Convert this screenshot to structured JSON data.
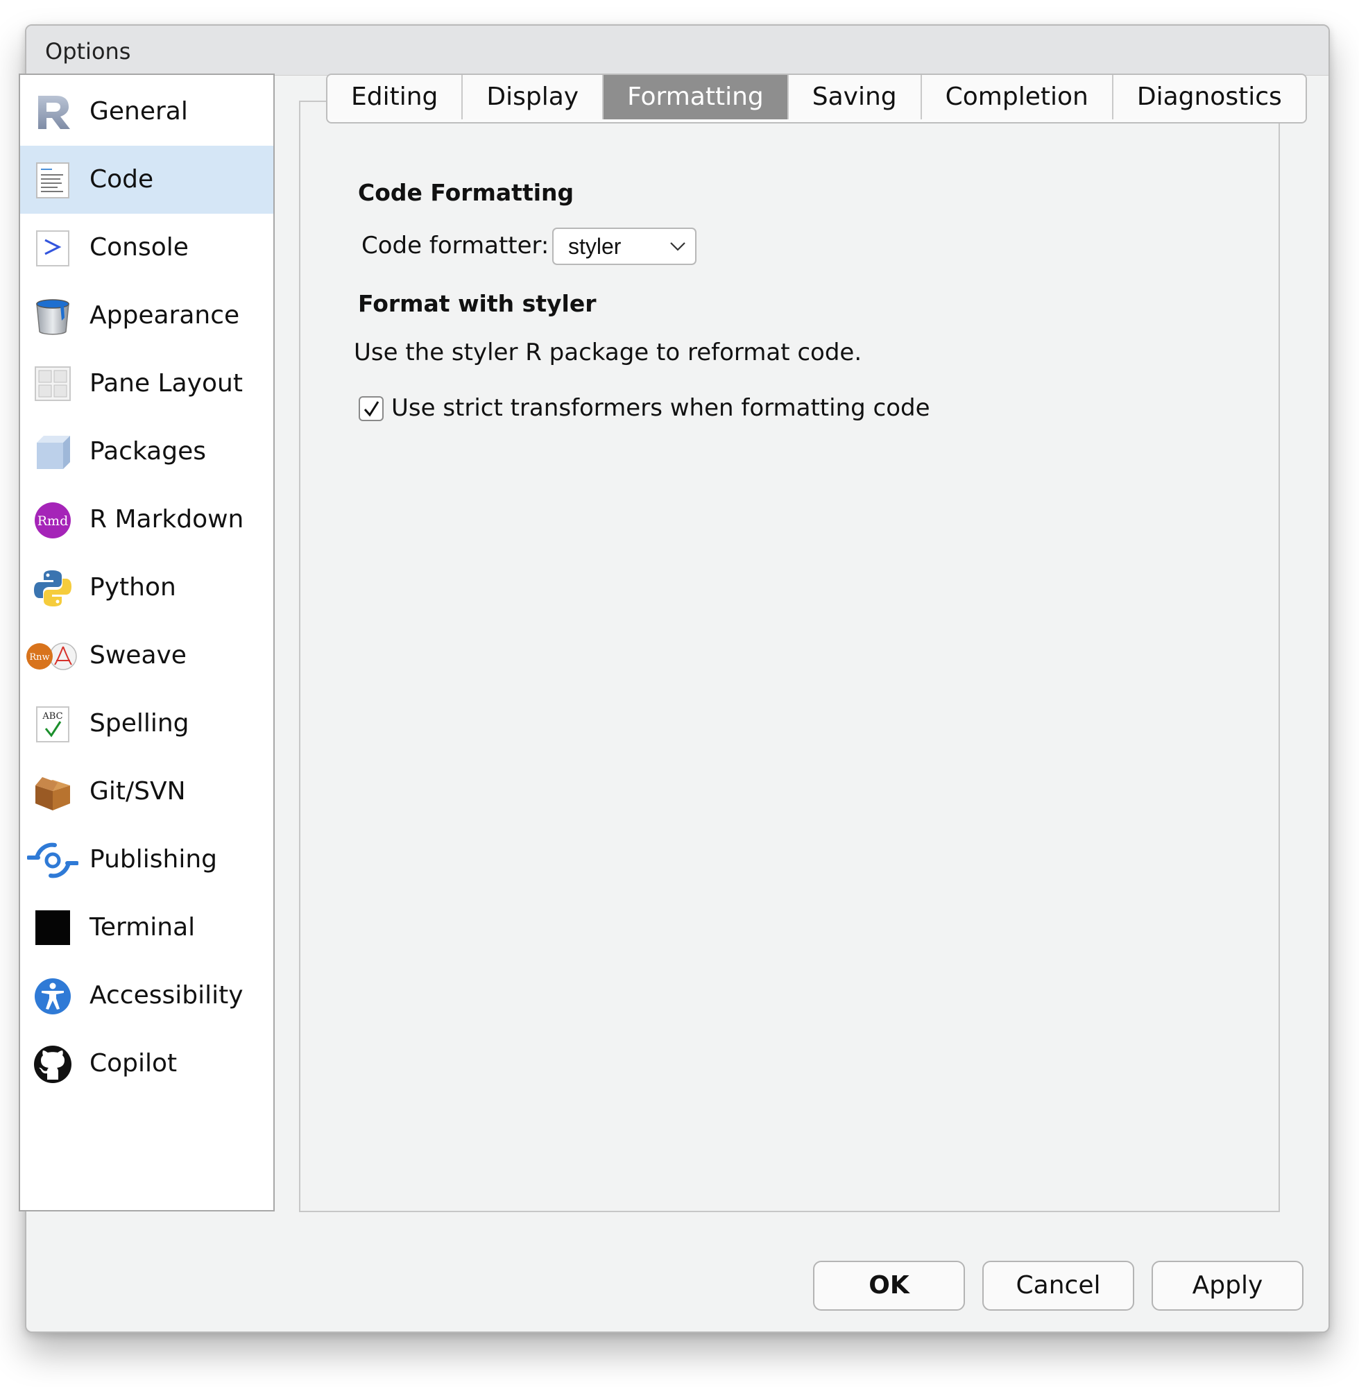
{
  "window": {
    "title": "Options"
  },
  "sidebar": {
    "items": [
      {
        "label": "General",
        "icon": "r-logo-icon",
        "active": false
      },
      {
        "label": "Code",
        "icon": "code-document-icon",
        "active": true
      },
      {
        "label": "Console",
        "icon": "console-prompt-icon",
        "active": false
      },
      {
        "label": "Appearance",
        "icon": "paint-bucket-icon",
        "active": false
      },
      {
        "label": "Pane Layout",
        "icon": "pane-grid-icon",
        "active": false
      },
      {
        "label": "Packages",
        "icon": "package-box-icon",
        "active": false
      },
      {
        "label": "R Markdown",
        "icon": "rmd-icon",
        "active": false
      },
      {
        "label": "Python",
        "icon": "python-icon",
        "active": false
      },
      {
        "label": "Sweave",
        "icon": "sweave-icon",
        "active": false
      },
      {
        "label": "Spelling",
        "icon": "spelling-abc-icon",
        "active": false
      },
      {
        "label": "Git/SVN",
        "icon": "git-box-icon",
        "active": false
      },
      {
        "label": "Publishing",
        "icon": "publishing-icon",
        "active": false
      },
      {
        "label": "Terminal",
        "icon": "terminal-icon",
        "active": false
      },
      {
        "label": "Accessibility",
        "icon": "accessibility-icon",
        "active": false
      },
      {
        "label": "Copilot",
        "icon": "github-icon",
        "active": false
      }
    ],
    "icon_labels": {
      "rmd": "Rmd",
      "rnw": "Rnw",
      "abc": "ABC"
    }
  },
  "tabs": [
    {
      "label": "Editing",
      "selected": false
    },
    {
      "label": "Display",
      "selected": false
    },
    {
      "label": "Formatting",
      "selected": true
    },
    {
      "label": "Saving",
      "selected": false
    },
    {
      "label": "Completion",
      "selected": false
    },
    {
      "label": "Diagnostics",
      "selected": false
    }
  ],
  "content": {
    "section1_heading": "Code Formatting",
    "formatter_label": "Code formatter:",
    "formatter_value": "styler",
    "section2_heading": "Format with styler",
    "description": "Use the styler R package to reformat code.",
    "strict_checkbox_label": "Use strict transformers when formatting code",
    "strict_checked": true
  },
  "buttons": {
    "ok": "OK",
    "cancel": "Cancel",
    "apply": "Apply"
  },
  "colors": {
    "active_item_bg": "#d5e6f6",
    "selected_tab_bg": "#8e8e8e",
    "dialog_bg": "#f2f3f3"
  }
}
